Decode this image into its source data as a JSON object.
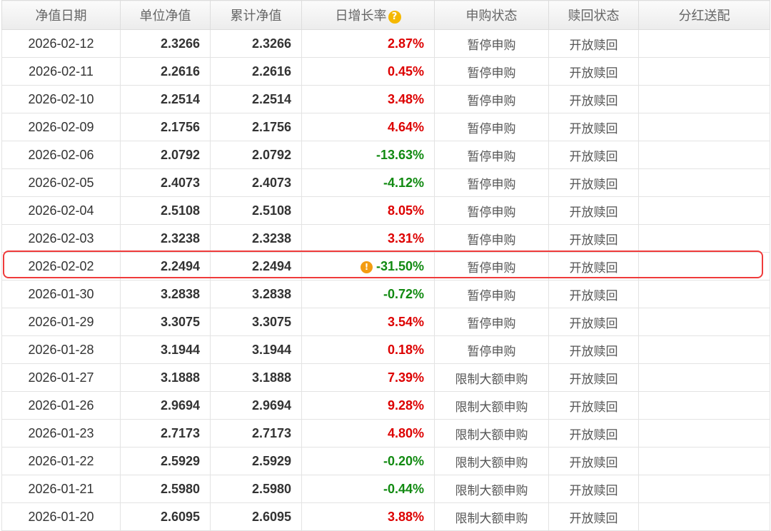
{
  "headers": {
    "date": "净值日期",
    "unit_nav": "单位净值",
    "acc_nav": "累计净值",
    "daily_growth": "日增长率",
    "purchase_status": "申购状态",
    "redeem_status": "赎回状态",
    "dividend": "分红送配"
  },
  "icons": {
    "help": "question-icon",
    "info": "info-icon"
  },
  "colors": {
    "up": "#dd0000",
    "down": "#118a11",
    "highlight": "#ef3b3b"
  },
  "rows": [
    {
      "date": "2026-02-12",
      "unit": "2.3266",
      "acc": "2.3266",
      "growth": "2.87%",
      "dir": "up",
      "purchase": "暂停申购",
      "redeem": "开放赎回",
      "dividend": ""
    },
    {
      "date": "2026-02-11",
      "unit": "2.2616",
      "acc": "2.2616",
      "growth": "0.45%",
      "dir": "up",
      "purchase": "暂停申购",
      "redeem": "开放赎回",
      "dividend": ""
    },
    {
      "date": "2026-02-10",
      "unit": "2.2514",
      "acc": "2.2514",
      "growth": "3.48%",
      "dir": "up",
      "purchase": "暂停申购",
      "redeem": "开放赎回",
      "dividend": ""
    },
    {
      "date": "2026-02-09",
      "unit": "2.1756",
      "acc": "2.1756",
      "growth": "4.64%",
      "dir": "up",
      "purchase": "暂停申购",
      "redeem": "开放赎回",
      "dividend": ""
    },
    {
      "date": "2026-02-06",
      "unit": "2.0792",
      "acc": "2.0792",
      "growth": "-13.63%",
      "dir": "down",
      "purchase": "暂停申购",
      "redeem": "开放赎回",
      "dividend": ""
    },
    {
      "date": "2026-02-05",
      "unit": "2.4073",
      "acc": "2.4073",
      "growth": "-4.12%",
      "dir": "down",
      "purchase": "暂停申购",
      "redeem": "开放赎回",
      "dividend": ""
    },
    {
      "date": "2026-02-04",
      "unit": "2.5108",
      "acc": "2.5108",
      "growth": "8.05%",
      "dir": "up",
      "purchase": "暂停申购",
      "redeem": "开放赎回",
      "dividend": ""
    },
    {
      "date": "2026-02-03",
      "unit": "2.3238",
      "acc": "2.3238",
      "growth": "3.31%",
      "dir": "up",
      "purchase": "暂停申购",
      "redeem": "开放赎回",
      "dividend": ""
    },
    {
      "date": "2026-02-02",
      "unit": "2.2494",
      "acc": "2.2494",
      "growth": "-31.50%",
      "dir": "down",
      "info": true,
      "highlighted": true,
      "purchase": "暂停申购",
      "redeem": "开放赎回",
      "dividend": ""
    },
    {
      "date": "2026-01-30",
      "unit": "3.2838",
      "acc": "3.2838",
      "growth": "-0.72%",
      "dir": "down",
      "purchase": "暂停申购",
      "redeem": "开放赎回",
      "dividend": ""
    },
    {
      "date": "2026-01-29",
      "unit": "3.3075",
      "acc": "3.3075",
      "growth": "3.54%",
      "dir": "up",
      "purchase": "暂停申购",
      "redeem": "开放赎回",
      "dividend": ""
    },
    {
      "date": "2026-01-28",
      "unit": "3.1944",
      "acc": "3.1944",
      "growth": "0.18%",
      "dir": "up",
      "purchase": "暂停申购",
      "redeem": "开放赎回",
      "dividend": ""
    },
    {
      "date": "2026-01-27",
      "unit": "3.1888",
      "acc": "3.1888",
      "growth": "7.39%",
      "dir": "up",
      "purchase": "限制大额申购",
      "redeem": "开放赎回",
      "dividend": ""
    },
    {
      "date": "2026-01-26",
      "unit": "2.9694",
      "acc": "2.9694",
      "growth": "9.28%",
      "dir": "up",
      "purchase": "限制大额申购",
      "redeem": "开放赎回",
      "dividend": ""
    },
    {
      "date": "2026-01-23",
      "unit": "2.7173",
      "acc": "2.7173",
      "growth": "4.80%",
      "dir": "up",
      "purchase": "限制大额申购",
      "redeem": "开放赎回",
      "dividend": ""
    },
    {
      "date": "2026-01-22",
      "unit": "2.5929",
      "acc": "2.5929",
      "growth": "-0.20%",
      "dir": "down",
      "purchase": "限制大额申购",
      "redeem": "开放赎回",
      "dividend": ""
    },
    {
      "date": "2026-01-21",
      "unit": "2.5980",
      "acc": "2.5980",
      "growth": "-0.44%",
      "dir": "down",
      "purchase": "限制大额申购",
      "redeem": "开放赎回",
      "dividend": ""
    },
    {
      "date": "2026-01-20",
      "unit": "2.6095",
      "acc": "2.6095",
      "growth": "3.88%",
      "dir": "up",
      "purchase": "限制大额申购",
      "redeem": "开放赎回",
      "dividend": ""
    }
  ]
}
